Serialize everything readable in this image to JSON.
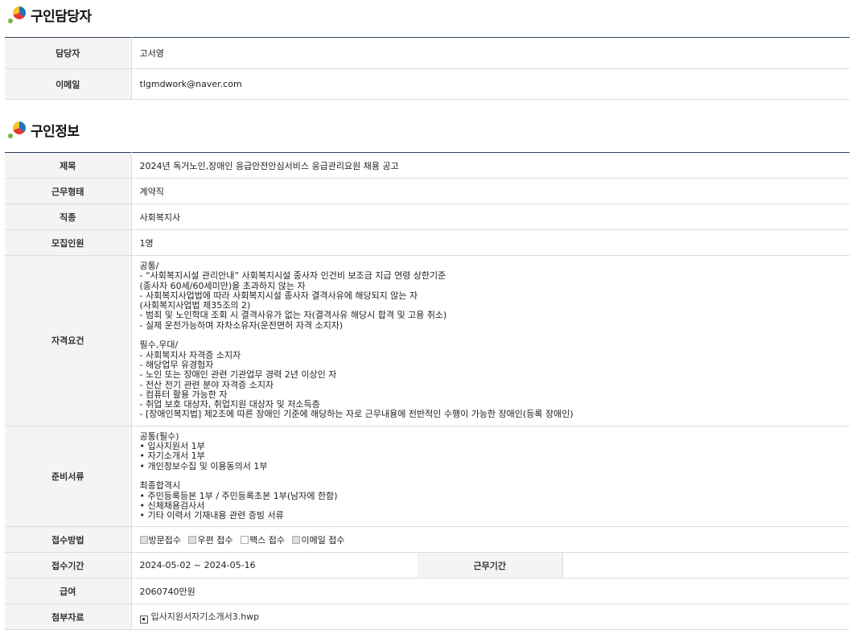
{
  "contact_section": {
    "title": "구인담당자",
    "rows": [
      {
        "label": "담당자",
        "value": "고서영"
      },
      {
        "label": "이메일",
        "value": "tlgmdwork@naver.com"
      }
    ]
  },
  "job_section": {
    "title": "구인정보",
    "title_row": {
      "label": "제목",
      "value": "2024년 독거노인,장애인 응급안전안심서비스 응급관리요원 채용 공고"
    },
    "employment_type": {
      "label": "근무형태",
      "value": "계약직"
    },
    "job_category": {
      "label": "직종",
      "value": "사회복지사"
    },
    "headcount": {
      "label": "모집인원",
      "value": "1명"
    },
    "qualifications": {
      "label": "자격요건",
      "value": "공통/\n- “사회복지시설 관리안내” 사회복지시설 종사자 인건비 보조금 지급 연령 상한기준\n (종사자 60세/60세미만)을 초과하지 않는 자\n- 사회복지사업법에 따라 사회복지시설 종사자 결격사유에 해당되지 않는 자\n (사회복지사업법 제35조의 2)\n- 범죄 및 노인학대 조회 시 결격사유가 없는 자(결격사유 해당시 합격 및 고용 취소)\n- 실제 운전가능하며 자차소유자(운전면허 자격 소지자)\n\n필수,우대/\n- 사회복지사 자격증 소지자\n- 해당업무 유경험자\n- 노인 또는 장애인 관련 기관업무 경력 2년 이상인 자\n- 전산 전기 관련 분야 자격증 소지자\n- 컴퓨터 활용 가능한 자\n- 취업 보호 대상자, 취업지원 대상자 및 저소득층\n- [장애인복지법] 제2조에 따른 장애인 기준에 해당하는 자로 근무내용에 전반적인 수행이 가능한 장애인(등록 장애인)"
    },
    "documents": {
      "label": "준비서류",
      "value": "공통(필수)\n • 입사지원서 1부\n • 자기소개서 1부\n • 개인정보수집 및 이용동의서 1부\n\n최종합격시\n • 주민등록등본 1부 / 주민등록초본 1부(남자에 한함)\n • 신체채용검사서\n • 기타 이력서 기재내용 관련 증빙 서류"
    },
    "application_method": {
      "label": "접수방법",
      "options": [
        {
          "label": "방문접수",
          "checked": true
        },
        {
          "label": "우편 접수",
          "checked": true
        },
        {
          "label": "팩스 접수",
          "checked": false
        },
        {
          "label": "이메일 접수",
          "checked": true
        }
      ]
    },
    "application_period": {
      "label": "접수기간",
      "value": "2024-05-02 ~ 2024-05-16"
    },
    "work_period": {
      "label": "근무기간",
      "value": ""
    },
    "salary": {
      "label": "급여",
      "value": "2060740만원"
    },
    "attachments": {
      "label": "첨부자료",
      "file": "입사지원서자기소개서3.hwp",
      "icon": "file-icon"
    }
  }
}
